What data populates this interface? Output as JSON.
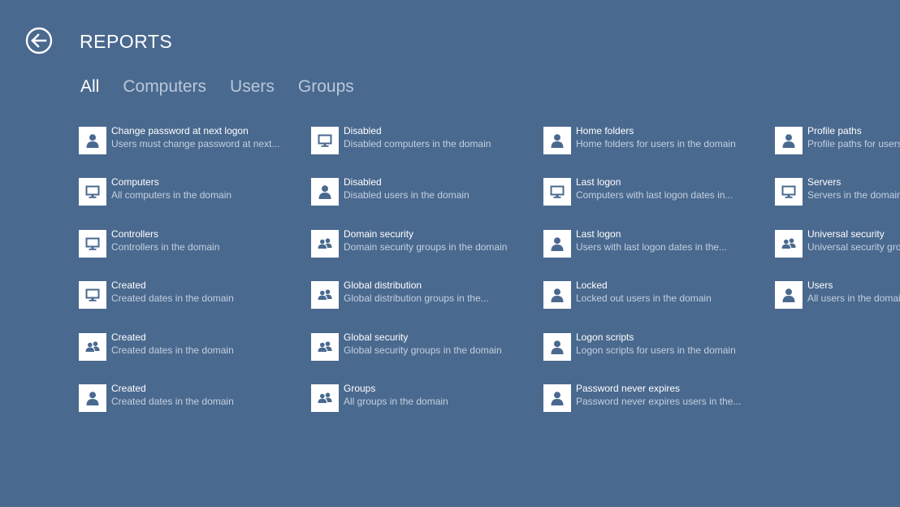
{
  "header": {
    "title": "REPORTS",
    "back_icon": "back-arrow-icon"
  },
  "tabs": [
    {
      "label": "All",
      "active": true
    },
    {
      "label": "Computers",
      "active": false
    },
    {
      "label": "Users",
      "active": false
    },
    {
      "label": "Groups",
      "active": false
    }
  ],
  "colors": {
    "background": "#4a698f",
    "icon": "#4a698f",
    "tile": "#ffffff"
  },
  "reports": [
    [
      {
        "title": "Change password at next logon",
        "subtitle": "Users must change password at next...",
        "icon": "user-icon"
      },
      {
        "title": "Computers",
        "subtitle": "All computers in the domain",
        "icon": "monitor-icon"
      },
      {
        "title": "Controllers",
        "subtitle": "Controllers in the domain",
        "icon": "monitor-icon"
      },
      {
        "title": "Created",
        "subtitle": "Created dates in the domain",
        "icon": "monitor-icon"
      },
      {
        "title": "Created",
        "subtitle": "Created dates in the domain",
        "icon": "group-icon"
      },
      {
        "title": "Created",
        "subtitle": "Created dates in the domain",
        "icon": "user-icon"
      }
    ],
    [
      {
        "title": "Disabled",
        "subtitle": "Disabled computers in the domain",
        "icon": "monitor-icon"
      },
      {
        "title": "Disabled",
        "subtitle": "Disabled users in the domain",
        "icon": "user-icon"
      },
      {
        "title": "Domain security",
        "subtitle": "Domain security groups in the domain",
        "icon": "group-icon"
      },
      {
        "title": "Global distribution",
        "subtitle": "Global distribution groups in the...",
        "icon": "group-icon"
      },
      {
        "title": "Global security",
        "subtitle": "Global security groups in the domain",
        "icon": "group-icon"
      },
      {
        "title": "Groups",
        "subtitle": "All groups in the domain",
        "icon": "group-icon"
      }
    ],
    [
      {
        "title": "Home folders",
        "subtitle": "Home folders for users in the domain",
        "icon": "user-icon"
      },
      {
        "title": "Last logon",
        "subtitle": "Computers with last logon dates in...",
        "icon": "monitor-icon"
      },
      {
        "title": "Last logon",
        "subtitle": "Users with last logon dates in the...",
        "icon": "user-icon"
      },
      {
        "title": "Locked",
        "subtitle": "Locked out users in the domain",
        "icon": "user-icon"
      },
      {
        "title": "Logon scripts",
        "subtitle": "Logon scripts for users in the domain",
        "icon": "user-icon"
      },
      {
        "title": "Password never expires",
        "subtitle": "Password never expires users in the...",
        "icon": "user-icon"
      }
    ],
    [
      {
        "title": "Profile paths",
        "subtitle": "Profile paths for users in the domain",
        "icon": "user-icon"
      },
      {
        "title": "Servers",
        "subtitle": "Servers in the domain",
        "icon": "monitor-icon"
      },
      {
        "title": "Universal security",
        "subtitle": "Universal security groups in the domain",
        "icon": "group-icon"
      },
      {
        "title": "Users",
        "subtitle": "All users in the domain",
        "icon": "user-icon"
      }
    ]
  ]
}
